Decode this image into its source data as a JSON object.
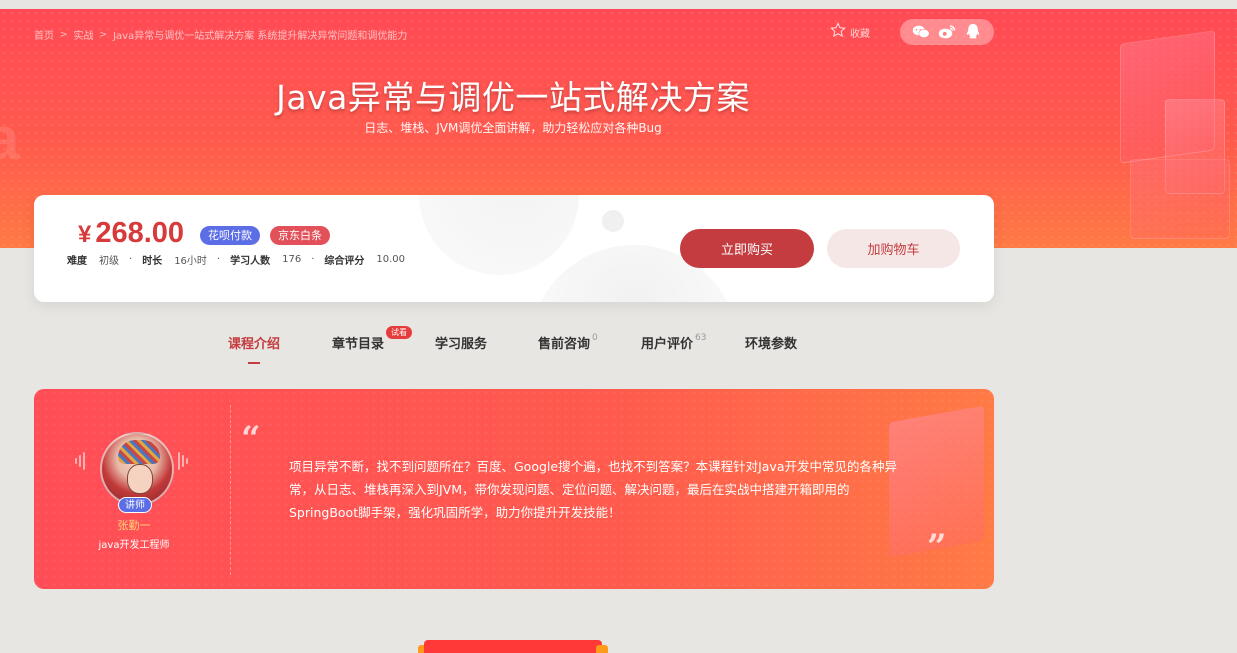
{
  "breadcrumb": {
    "items": [
      "首页",
      "实战",
      "Java异常与调优一站式解决方案 系统提升解决异常问题和调优能力"
    ],
    "separator": ">"
  },
  "favorite_label": "收藏",
  "share_icons": [
    "wechat-icon",
    "weibo-icon",
    "qq-icon"
  ],
  "course": {
    "title": "Java异常与调优一站式解决方案",
    "subtitle": "日志、堆栈、JVM调优全面讲解，助力轻松应对各种Bug"
  },
  "pricing": {
    "currency": "¥",
    "price": "268.00",
    "tags": [
      "花呗付款",
      "京东白条"
    ],
    "meta": [
      {
        "key": "难度",
        "value": "初级"
      },
      {
        "key": "时长",
        "value": "16小时"
      },
      {
        "key": "学习人数",
        "value": "176"
      },
      {
        "key": "综合评分",
        "value": "10.00"
      }
    ],
    "buy_label": "立即购买",
    "cart_label": "加购物车"
  },
  "tabs": [
    {
      "label": "课程介绍",
      "active": true,
      "count": ""
    },
    {
      "label": "章节目录",
      "active": false,
      "count": "",
      "badge": "试看"
    },
    {
      "label": "学习服务",
      "active": false,
      "count": ""
    },
    {
      "label": "售前咨询",
      "active": false,
      "count": "0"
    },
    {
      "label": "用户评价",
      "active": false,
      "count": "63"
    },
    {
      "label": "环境参数",
      "active": false,
      "count": ""
    }
  ],
  "teacher": {
    "badge": "讲师",
    "name": "张勤一",
    "role": "java开发工程师"
  },
  "intro": {
    "open_quote": "“",
    "close_quote": "”",
    "text": "项目异常不断，找不到问题所在？百度、Google搜个遍，也找不到答案？本课程针对Java开发中常见的各种异常，从日志、堆栈再深入到JVM，带你发现问题、定位问题、解决问题，最后在实战中搭建开箱即用的SpringBoot脚手架，强化巩固所学，助力你提升开发技能！"
  },
  "colors": {
    "accent": "#c43c3f",
    "banner_red": "#ff4a55",
    "banner_orange": "#ff7a45",
    "tag_blue": "#5b6ee6"
  }
}
